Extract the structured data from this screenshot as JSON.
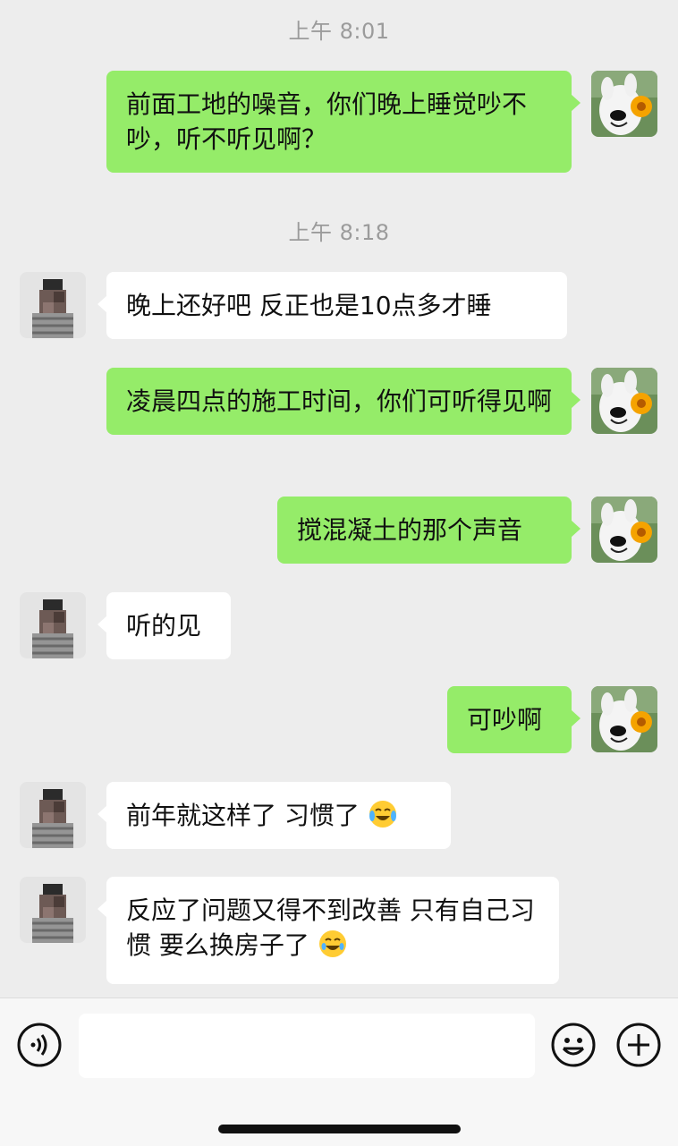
{
  "chat": {
    "timestamps": [
      "上午 8:01",
      "上午 8:18"
    ],
    "messages": [
      {
        "side": "out",
        "text": "前面工地的噪音，你们晚上睡觉吵不吵，听不听见啊？"
      },
      {
        "side": "in",
        "text": "晚上还好吧  反正也是10点多才睡"
      },
      {
        "side": "out",
        "text": "凌晨四点的施工时间，你们可听得见啊"
      },
      {
        "side": "out",
        "text": "搅混凝土的那个声音"
      },
      {
        "side": "in",
        "text": "听的见"
      },
      {
        "side": "out",
        "text": "可吵啊"
      },
      {
        "side": "in",
        "text": "前年就这样了  习惯了",
        "emoji": "crying-laughing-emoji"
      },
      {
        "side": "in",
        "text": "反应了问题又得不到改善  只有自己习惯  要么换房子了",
        "emoji": "laughing-emoji"
      }
    ]
  },
  "icons": {
    "voice": "voice-input-icon",
    "emoji": "emoji-smile-icon",
    "plus": "plus-icon",
    "self_avatar": "dog-with-flower-avatar",
    "other_avatar": "blurred-person-avatar"
  },
  "colors": {
    "background": "#ededed",
    "outgoing_bubble": "#95ec69",
    "incoming_bubble": "#ffffff",
    "timestamp": "#9b9b9b"
  }
}
